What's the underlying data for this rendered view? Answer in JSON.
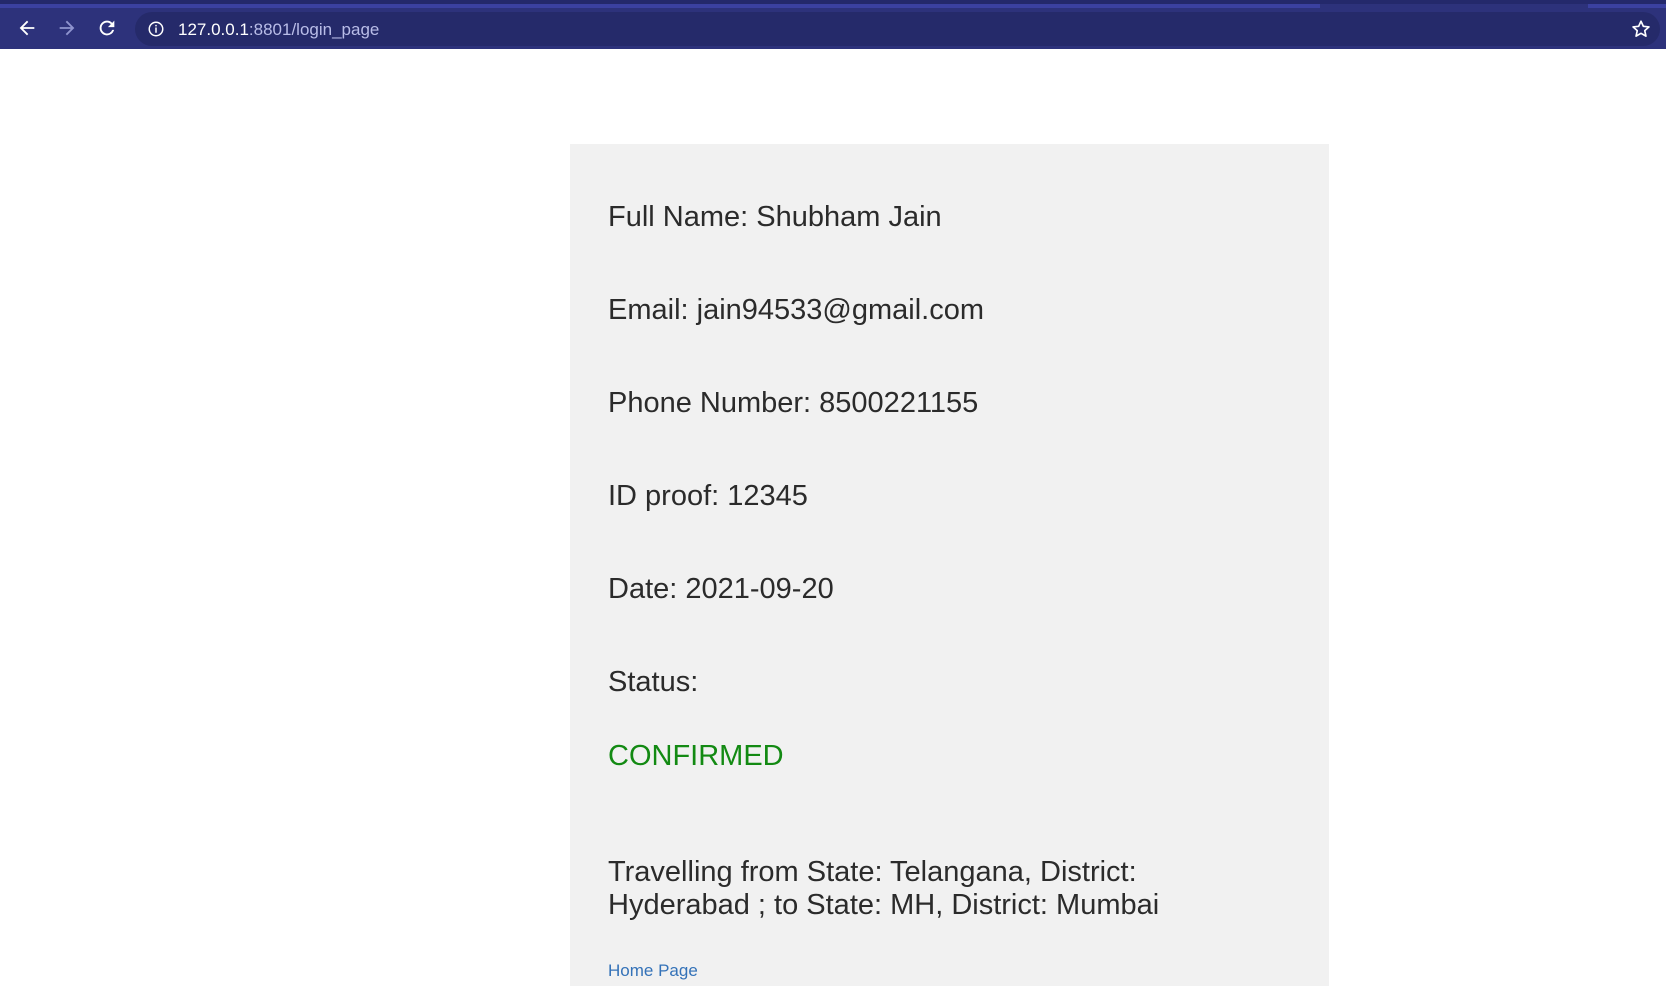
{
  "browser": {
    "url_host": "127.0.0.1",
    "url_rest": ":8801/login_page"
  },
  "details": {
    "full_name": "Full Name: Shubham Jain",
    "email": "Email: jain94533@gmail.com",
    "phone": "Phone Number: 8500221155",
    "id_proof": "ID proof: 12345",
    "date": "Date: 2021-09-20",
    "status_label": "Status:",
    "status_value": "CONFIRMED",
    "travel": "Travelling from State: Telangana, District: Hyderabad ; to State: MH, District: Mumbai",
    "home_link": "Home Page"
  },
  "colors": {
    "toolbar": "#2d327b",
    "status_confirmed": "#138a13",
    "link": "#3472b8",
    "card_bg": "#f1f1f1"
  },
  "icons": [
    "back-arrow-icon",
    "forward-arrow-icon",
    "reload-icon",
    "info-icon",
    "star-icon"
  ]
}
